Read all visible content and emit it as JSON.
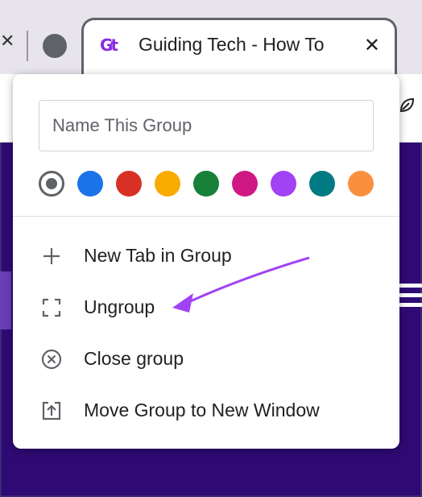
{
  "tab": {
    "title": "Guiding Tech - How To",
    "favicon_text": "Gt",
    "close_glyph": "✕"
  },
  "left_tab_close_glyph": "✕",
  "popup": {
    "name_placeholder": "Name This Group",
    "name_value": "",
    "colors": [
      {
        "name": "grey",
        "hex": "#5f6368",
        "selected": true
      },
      {
        "name": "blue",
        "hex": "#1a73e8",
        "selected": false
      },
      {
        "name": "red",
        "hex": "#d93025",
        "selected": false
      },
      {
        "name": "yellow",
        "hex": "#f9ab00",
        "selected": false
      },
      {
        "name": "green",
        "hex": "#188038",
        "selected": false
      },
      {
        "name": "pink",
        "hex": "#d01884",
        "selected": false
      },
      {
        "name": "purple",
        "hex": "#a142f4",
        "selected": false
      },
      {
        "name": "cyan",
        "hex": "#007b83",
        "selected": false
      },
      {
        "name": "orange",
        "hex": "#fa903e",
        "selected": false
      }
    ],
    "menu": [
      {
        "label": "New Tab in Group",
        "icon": "plus-icon"
      },
      {
        "label": "Ungroup",
        "icon": "ungroup-icon"
      },
      {
        "label": "Close group",
        "icon": "close-circle-icon"
      },
      {
        "label": "Move Group to New Window",
        "icon": "move-window-icon"
      }
    ]
  },
  "annotation": {
    "color": "#a142f4"
  },
  "page_bg_color": "#2f0a74"
}
